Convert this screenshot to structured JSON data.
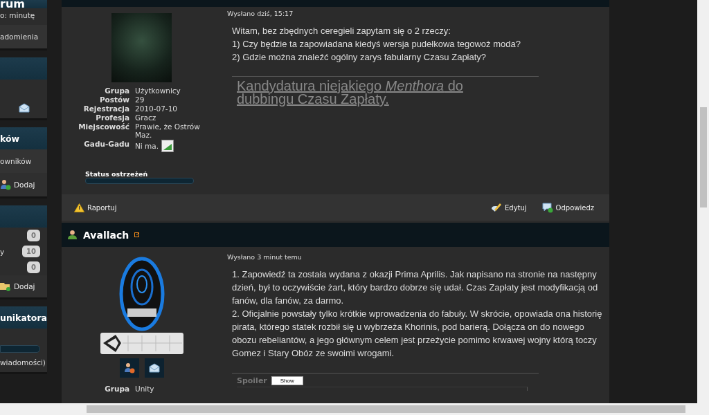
{
  "sidebar": {
    "blocks": [
      {
        "title": "rum",
        "rows": [
          {
            "kind": "text",
            "label": "o: minutę"
          },
          {
            "kind": "row",
            "label": "adomienia"
          }
        ]
      },
      {
        "rows": [
          {
            "kind": "mail-action"
          }
        ]
      },
      {
        "title": "ków",
        "rows": [
          {
            "kind": "row",
            "label": "owników"
          },
          {
            "kind": "user-action",
            "label": "Dodaj"
          }
        ]
      },
      {
        "rows": [
          {
            "kind": "counter",
            "label": "",
            "value": "0"
          },
          {
            "kind": "counter",
            "label": "y",
            "value": "10"
          },
          {
            "kind": "counter",
            "label": "",
            "value": "0"
          },
          {
            "kind": "folder-action",
            "label": "Dodaj"
          }
        ]
      },
      {
        "title": "unikatora",
        "rows": [
          {
            "kind": "progress",
            "level": 0
          },
          {
            "kind": "text",
            "label": "wiadomości)"
          }
        ]
      }
    ]
  },
  "posts": [
    {
      "avatar": {
        "kind": "photo"
      },
      "profile": [
        {
          "label": "Grupa",
          "value": "Użytkownicy"
        },
        {
          "label": "Postów",
          "value": "29"
        },
        {
          "label": "Rejestracja",
          "value": "2010-07-10"
        },
        {
          "label": "Profesja",
          "value": "Gracz"
        },
        {
          "label": "Miejscowość",
          "value": "Prawie, że Ostrów Maz."
        },
        {
          "label": "Gadu-Gadu",
          "value": "Ni ma.",
          "kind": "gadu"
        }
      ],
      "warning": {
        "label": "Status ostrzeżeń",
        "level": 0
      },
      "date": "Wysłano dziś, 15:17",
      "body": [
        "Witam, bez zbędnych ceregieli zapytam się o 2 rzeczy:",
        "1) Czy będzie ta zapowiadana kiedyś wersja pudełkowa tegowoż moda?",
        "2) Gdzie można znaleźć ogólny zarys fabularny Czasu Zapłaty?"
      ],
      "signature": {
        "kind": "link",
        "text": "Kandydatura niejakiego *Menthora* do dubbingu Czasu Zapłaty."
      },
      "actions": [
        {
          "kind": "report",
          "label": "Raportuj"
        },
        {
          "kind": "edit",
          "label": "Edytuj"
        },
        {
          "kind": "reply",
          "label": "Odpowiedz"
        }
      ]
    },
    {
      "author": "Avallach",
      "avatar": {
        "kind": "logo"
      },
      "profile": [
        {
          "label": "Grupa",
          "value": "Unity"
        }
      ],
      "date": "Wysłano 3 minut temu",
      "body": [
        "1. Zapowiedź ta została wydana z okazji Prima Aprilis. Jak napisano na stronie na następny dzień, był to oczywiście żart, który bardzo dobrze się udał. Czas Zapłaty jest modyfikacją od fanów, dla fanów, za darmo.",
        "2. Oficjalnie powstały tylko krótkie wprowadzenia do fabuły. W skrócie, opowiada ona historię pirata, którego statek rozbił się u wybrzeża Khorinis, pod barierą. Dołącza on do nowego obozu rebeliantów, a jego głównym celem jest przeżycie pomimo krwawej wojny którą toczy Gomez i Stary Obóz ze swoimi wrogami."
      ],
      "signature": {
        "kind": "spoiler",
        "text": "Spoiler",
        "button": "Show"
      }
    }
  ]
}
